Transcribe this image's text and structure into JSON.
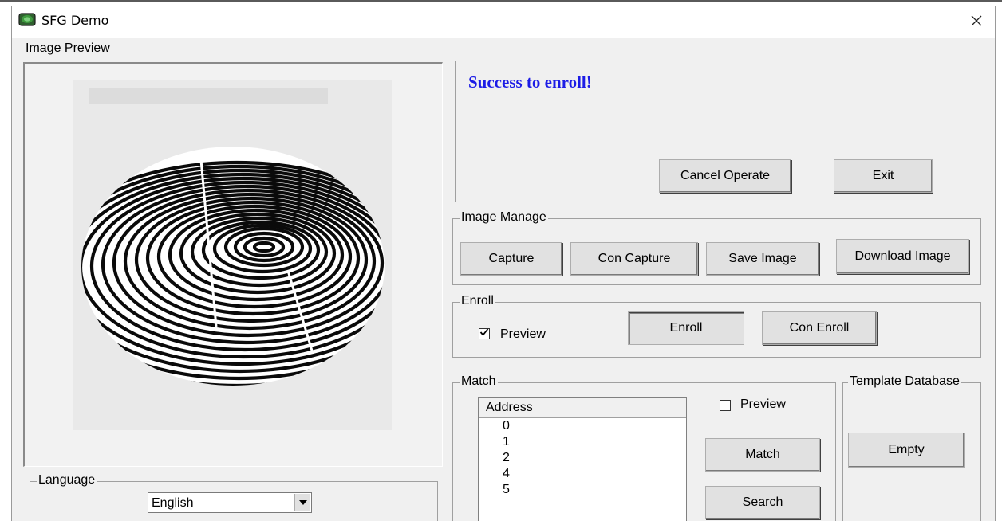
{
  "window": {
    "title": "SFG Demo"
  },
  "image_preview": {
    "label": "Image Preview"
  },
  "status": {
    "message": "Success to enroll!",
    "color": "#1c1ce6"
  },
  "buttons": {
    "cancel_operate": "Cancel Operate",
    "exit": "Exit"
  },
  "image_manage": {
    "title": "Image Manage",
    "capture": "Capture",
    "con_capture": "Con Capture",
    "save_image": "Save Image",
    "download_image": "Download Image"
  },
  "enroll": {
    "title": "Enroll",
    "preview_label": "Preview",
    "preview_checked": true,
    "enroll_button": "Enroll",
    "con_enroll_button": "Con Enroll"
  },
  "match": {
    "title": "Match",
    "column_header": "Address",
    "addresses": [
      "0",
      "1",
      "2",
      "4",
      "5"
    ],
    "preview_label": "Preview",
    "preview_checked": false,
    "match_button": "Match",
    "search_button": "Search"
  },
  "template_database": {
    "title": "Template Database",
    "empty_button": "Empty"
  },
  "language": {
    "title": "Language",
    "selected": "English"
  },
  "icons": {
    "app": "fingerprint-device-icon",
    "close": "close-icon",
    "dropdown": "chevron-down-icon",
    "check": "checkmark-icon"
  }
}
